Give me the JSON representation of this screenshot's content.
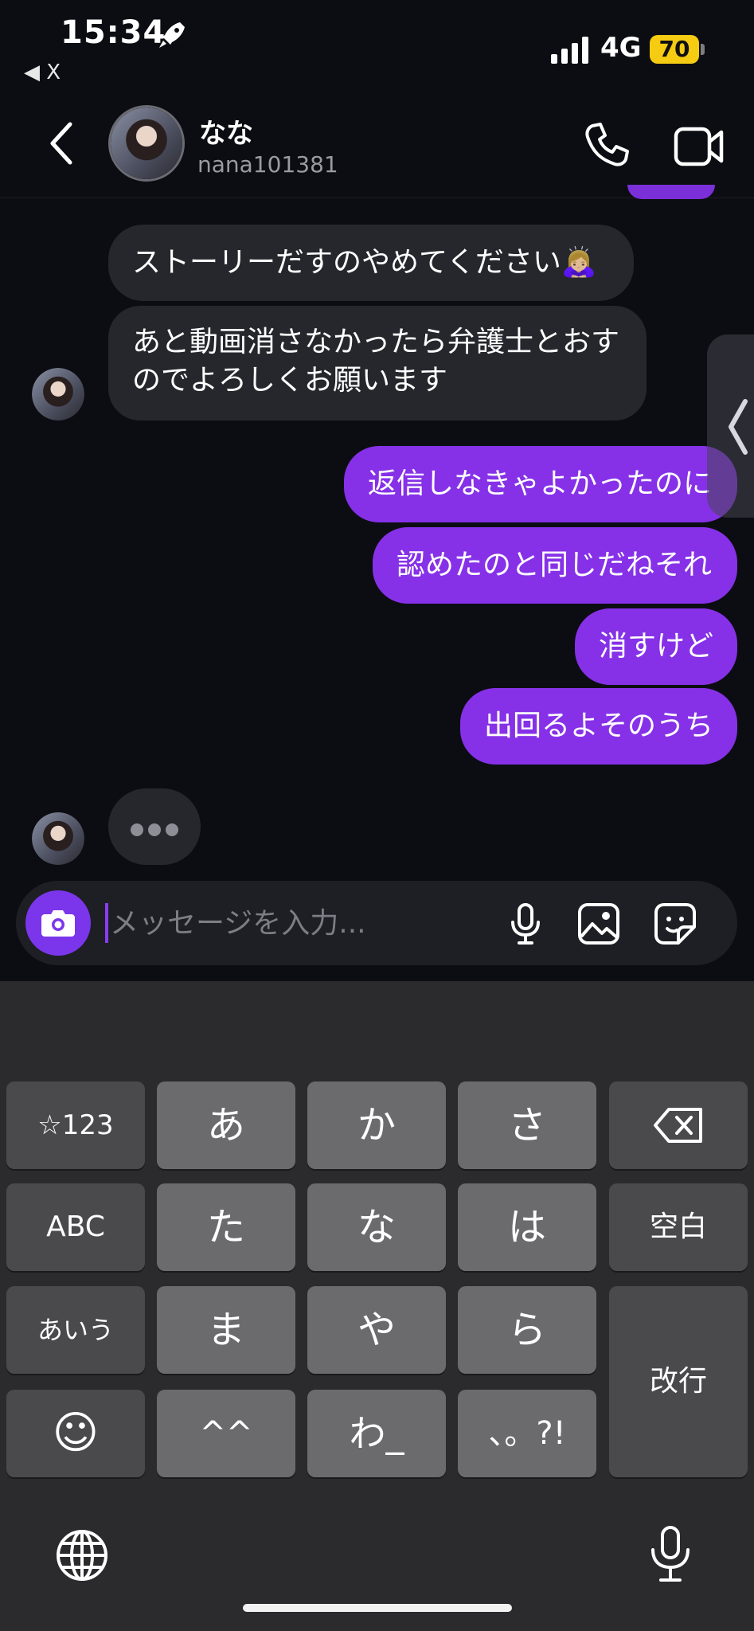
{
  "status_bar": {
    "time": "15:34",
    "back_app": "◀ X",
    "network": "4G",
    "battery": "70"
  },
  "header": {
    "name": "なな",
    "username": "nana101381"
  },
  "messages": {
    "incoming": [
      "ストーリーだすのやめてください🙇🏼‍♀️",
      "あと動画消さなかったら弁護士とおすのでよろしくお願います"
    ],
    "outgoing": [
      "返信しなきゃよかったのに",
      "認めたのと同じだねそれ",
      "消すけど",
      "出回るよそのうち"
    ]
  },
  "composer": {
    "placeholder": "メッセージを入力..."
  },
  "keyboard": {
    "rows": [
      [
        "☆123",
        "あ",
        "か",
        "さ",
        "⌫"
      ],
      [
        "ABC",
        "た",
        "な",
        "は",
        "空白"
      ],
      [
        "あいう",
        "ま",
        "や",
        "ら",
        "改行"
      ],
      [
        "☺",
        "^^",
        "わ_",
        "、。?!"
      ]
    ]
  },
  "colors": {
    "accent": "#8631e8",
    "battery": "#f5cc12",
    "background": "#0c0d12"
  }
}
